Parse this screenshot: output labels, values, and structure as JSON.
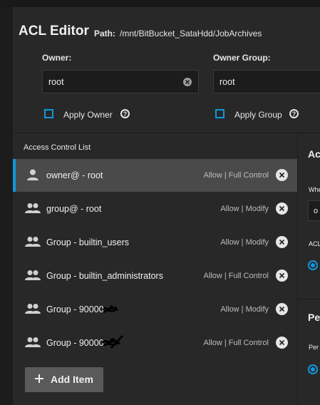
{
  "header": {
    "title": "ACL Editor",
    "path_label": "Path:",
    "path_value": "/mnt/BitBucket_SataHdd/JobArchives"
  },
  "owner": {
    "label": "Owner:",
    "value": "root",
    "apply_label": "Apply Owner"
  },
  "owner_group": {
    "label": "Owner Group:",
    "value": "root",
    "apply_label": "Apply Group"
  },
  "acl": {
    "heading": "Access Control List",
    "items": [
      {
        "name": "owner@ - root",
        "permission": "Allow | Full Control",
        "icon": "person-icon",
        "selected": true
      },
      {
        "name": "group@ - root",
        "permission": "Allow | Modify",
        "icon": "group-icon"
      },
      {
        "name": "Group - builtin_users",
        "permission": "Allow | Modify",
        "icon": "group-icon"
      },
      {
        "name": "Group - builtin_administrators",
        "permission": "Allow | Full Control",
        "icon": "group-icon"
      },
      {
        "name": "Group - 90000",
        "permission": "Allow | Modify",
        "icon": "group-icon"
      },
      {
        "name": "Group - 90000",
        "permission": "Allow | Full Control",
        "icon": "group-icon"
      }
    ],
    "add_label": "Add Item"
  },
  "right_panel": {
    "heading1": "Ac",
    "label1": "Whe",
    "input_value": "o",
    "label2": "ACL",
    "heading2": "Pe",
    "label3": "Per"
  },
  "colors": {
    "accent": "#0f98dc",
    "panel": "#282828",
    "background": "#1c1c1c"
  }
}
